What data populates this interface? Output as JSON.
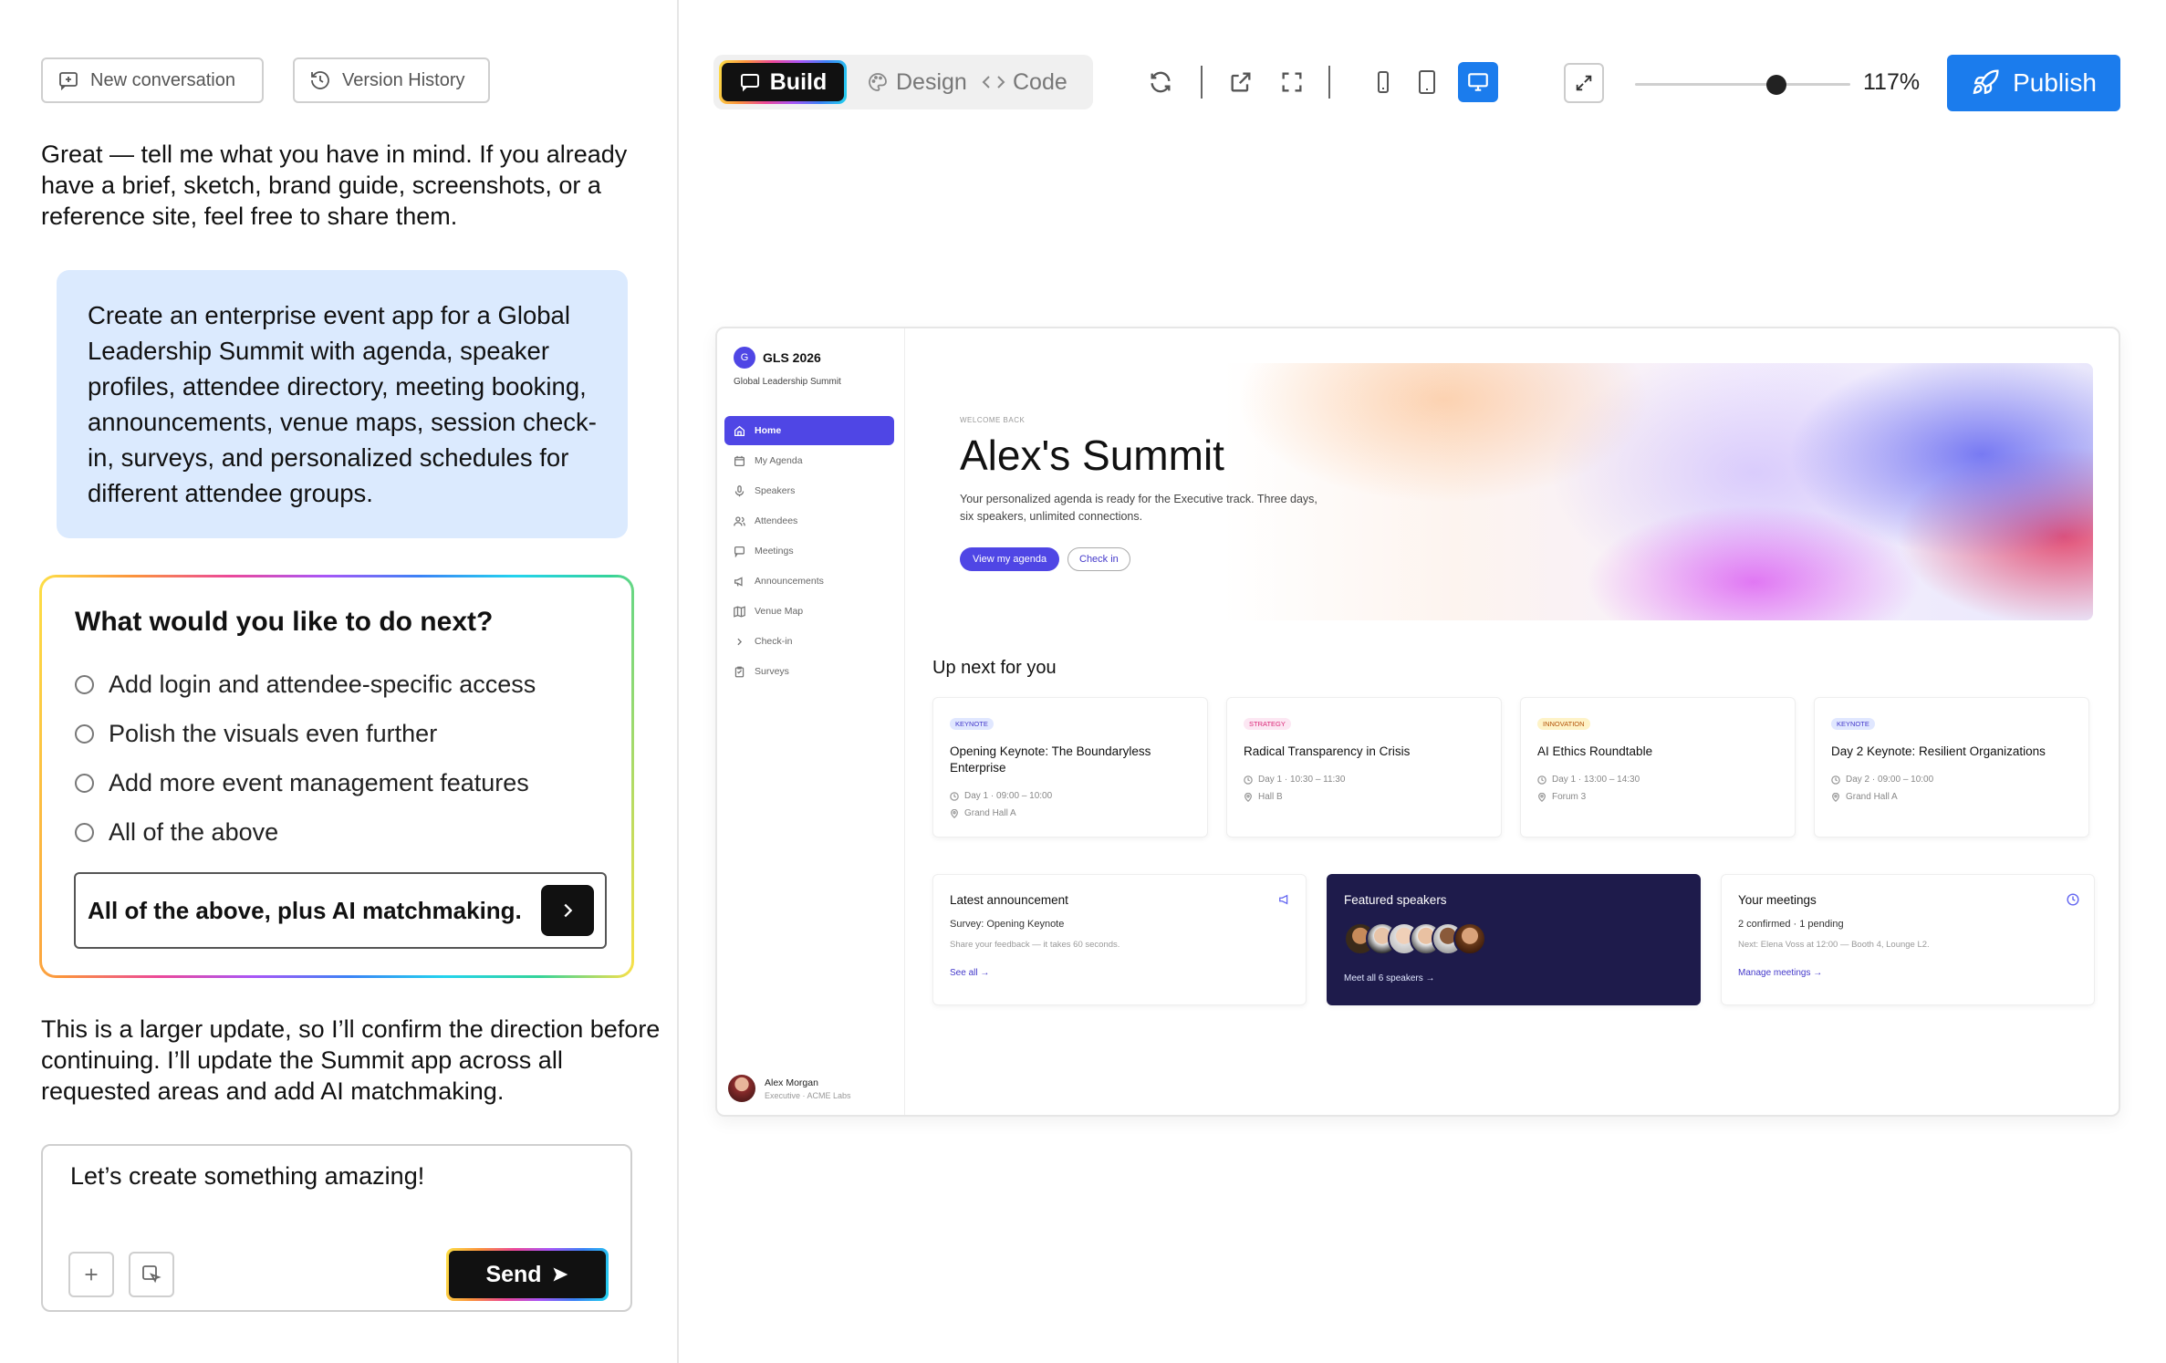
{
  "chat": {
    "new_conversation": "New conversation",
    "version_history": "Version History",
    "assistant_intro": "Great — tell me what you have in mind. If you already have a brief, sketch, brand guide, screenshots, or a reference site, feel free to share them.",
    "user_prompt": "Create an enterprise event app for a Global Leadership Summit with agenda, speaker profiles, attendee directory, meeting booking, announcements, venue maps, session check-in, surveys, and personalized schedules for different attendee groups.",
    "question": {
      "title": "What would you like to do next?",
      "options": [
        "Add login and attendee-specific access",
        "Polish the visuals even further",
        "Add more event management features",
        "All of the above"
      ],
      "input_value": "All of the above, plus AI matchmaking."
    },
    "assistant_followup": "This is a larger update, so I’ll confirm the direction before continuing. I’ll update the Summit app across all requested areas and add AI matchmaking.",
    "composer": {
      "placeholder": "Let’s create something amazing!",
      "send_label": "Send"
    }
  },
  "toolbar": {
    "modes": [
      "Build",
      "Design",
      "Code"
    ],
    "active_mode": "Build",
    "active_device": "desktop",
    "zoom": "117%",
    "zoom_fraction": 0.66,
    "publish_label": "Publish",
    "accent_color": "#1b7ced"
  },
  "preview": {
    "brand": {
      "logo_letter": "G",
      "name": "GLS 2026",
      "subtitle": "Global Leadership Summit"
    },
    "nav": [
      {
        "label": "Home",
        "icon": "home-icon",
        "active": true
      },
      {
        "label": "My Agenda",
        "icon": "calendar-icon"
      },
      {
        "label": "Speakers",
        "icon": "mic-icon"
      },
      {
        "label": "Attendees",
        "icon": "users-icon"
      },
      {
        "label": "Meetings",
        "icon": "chat-icon"
      },
      {
        "label": "Announcements",
        "icon": "megaphone-icon"
      },
      {
        "label": "Venue Map",
        "icon": "map-icon"
      },
      {
        "label": "Check-in",
        "icon": "chevron-right-icon"
      },
      {
        "label": "Surveys",
        "icon": "clipboard-icon"
      }
    ],
    "user": {
      "name": "Alex Morgan",
      "role": "Executive · ACME Labs"
    },
    "hero": {
      "eyebrow": "WELCOME BACK",
      "title": "Alex's Summit",
      "description": "Your personalized agenda is ready for the Executive track. Three days, six speakers, unlimited connections.",
      "primary_button": "View my agenda",
      "secondary_button": "Check in"
    },
    "up_next_title": "Up next for you",
    "sessions": [
      {
        "tag": "KEYNOTE",
        "title": "Opening Keynote: The Boundaryless Enterprise",
        "time": "Day 1 · 09:00 – 10:00",
        "room": "Grand Hall A"
      },
      {
        "tag": "STRATEGY",
        "title": "Radical Transparency in Crisis",
        "time": "Day 1 · 10:30 – 11:30",
        "room": "Hall B"
      },
      {
        "tag": "INNOVATION",
        "title": "AI Ethics Roundtable",
        "time": "Day 1 · 13:00 – 14:30",
        "room": "Forum 3"
      },
      {
        "tag": "KEYNOTE",
        "title": "Day 2 Keynote: Resilient Organizations",
        "time": "Day 2 · 09:00 – 10:00",
        "room": "Grand Hall A"
      }
    ],
    "announcement": {
      "title": "Latest announcement",
      "subtitle": "Survey: Opening Keynote",
      "text": "Share your feedback — it takes 60 seconds.",
      "link": "See all →"
    },
    "featured": {
      "title": "Featured speakers",
      "link": "Meet all 6 speakers →"
    },
    "meetings": {
      "title": "Your meetings",
      "subtitle": "2 confirmed · 1 pending",
      "text": "Next: Elena Voss at 12:00 — Booth 4, Lounge L2.",
      "link": "Manage meetings →"
    }
  }
}
